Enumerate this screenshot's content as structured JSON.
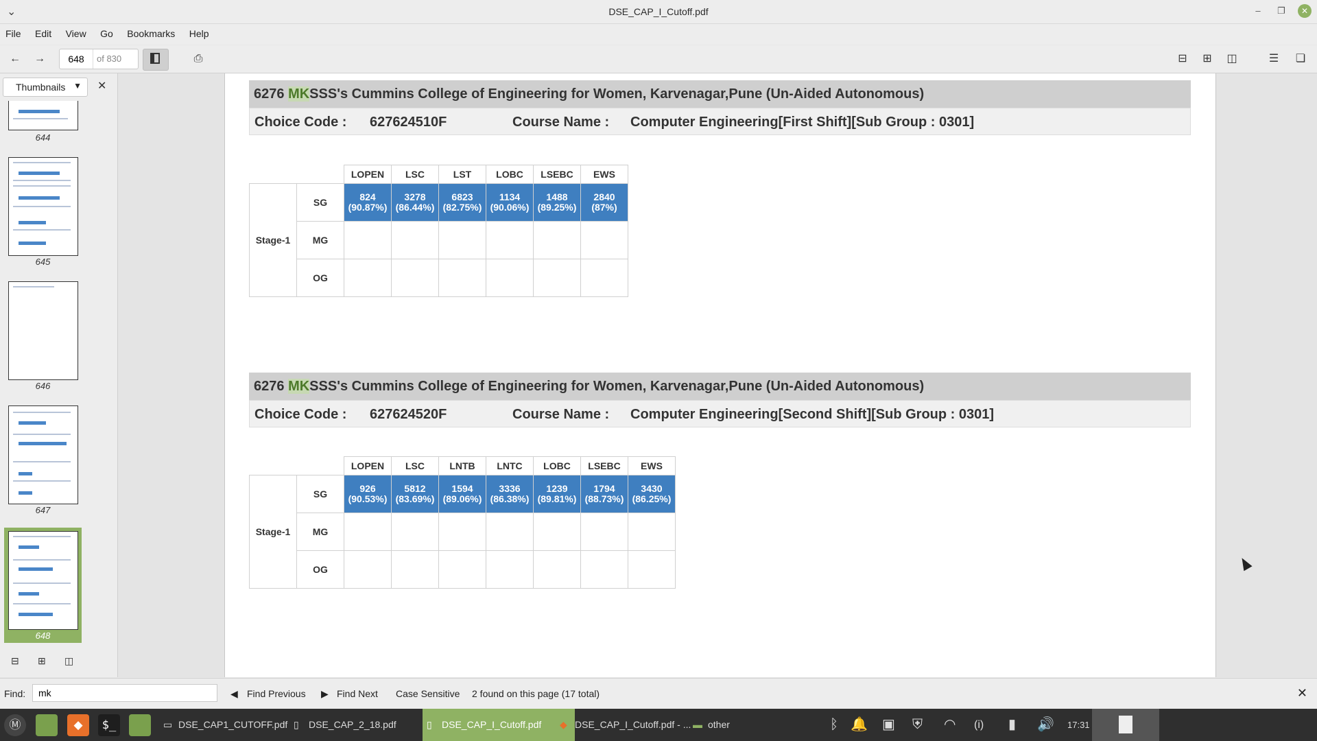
{
  "window": {
    "title": "DSE_CAP_I_Cutoff.pdf"
  },
  "menu": [
    "File",
    "Edit",
    "View",
    "Go",
    "Bookmarks",
    "Help"
  ],
  "toolbar": {
    "page_current": "648",
    "page_total": "of 830"
  },
  "sidebar": {
    "mode": "Thumbnails",
    "thumbnails": [
      {
        "num": "644"
      },
      {
        "num": "645"
      },
      {
        "num": "646"
      },
      {
        "num": "647"
      },
      {
        "num": "648",
        "selected": true
      }
    ]
  },
  "document": {
    "sections": [
      {
        "college_code": "6276",
        "college_highlight": "MK",
        "college_rest": "SSS's Cummins College of Engineering for Women, Karvenagar,Pune (Un-Aided Autonomous)",
        "choice_label": "Choice Code :",
        "choice_code": "627624510F",
        "course_label": "Course Name :",
        "course_name": "Computer Engineering[First Shift][Sub Group : 0301]",
        "stage": "Stage-1",
        "groups": [
          "SG",
          "MG",
          "OG"
        ],
        "columns": [
          "LOPEN",
          "LSC",
          "LST",
          "LOBC",
          "LSEBC",
          "EWS"
        ],
        "sg_values": [
          [
            "824",
            "(90.87%)"
          ],
          [
            "3278",
            "(86.44%)"
          ],
          [
            "6823",
            "(82.75%)"
          ],
          [
            "1134",
            "(90.06%)"
          ],
          [
            "1488",
            "(89.25%)"
          ],
          [
            "2840",
            "(87%)"
          ]
        ]
      },
      {
        "college_code": "6276",
        "college_highlight": "MK",
        "college_rest": "SSS's Cummins College of Engineering for Women, Karvenagar,Pune (Un-Aided Autonomous)",
        "choice_label": "Choice Code :",
        "choice_code": "627624520F",
        "course_label": "Course Name :",
        "course_name": "Computer Engineering[Second Shift][Sub Group : 0301]",
        "stage": "Stage-1",
        "groups": [
          "SG",
          "MG",
          "OG"
        ],
        "columns": [
          "LOPEN",
          "LSC",
          "LNTB",
          "LNTC",
          "LOBC",
          "LSEBC",
          "EWS"
        ],
        "sg_values": [
          [
            "926",
            "(90.53%)"
          ],
          [
            "5812",
            "(83.69%)"
          ],
          [
            "1594",
            "(89.06%)"
          ],
          [
            "3336",
            "(86.38%)"
          ],
          [
            "1239",
            "(89.81%)"
          ],
          [
            "1794",
            "(88.73%)"
          ],
          [
            "3430",
            "(86.25%)"
          ]
        ]
      }
    ]
  },
  "find": {
    "label": "Find:",
    "query": "mk",
    "prev": "Find Previous",
    "next": "Find Next",
    "case": "Case Sensitive",
    "status": "2 found on this page (17 total)"
  },
  "taskbar": {
    "windows": [
      {
        "label": "DSE_CAP1_CUTOFF.pdf",
        "active": false
      },
      {
        "label": "DSE_CAP_2_18.pdf",
        "active": false
      },
      {
        "label": "DSE_CAP_I_Cutoff.pdf",
        "active": true
      },
      {
        "label": "DSE_CAP_I_Cutoff.pdf - ...",
        "active": false
      },
      {
        "label": "other",
        "active": false
      }
    ],
    "clock": "17:31"
  },
  "colors": {
    "accent": "#8fb263",
    "cell_blue": "#3f7fc0",
    "header_gray": "#cfcfcf"
  }
}
